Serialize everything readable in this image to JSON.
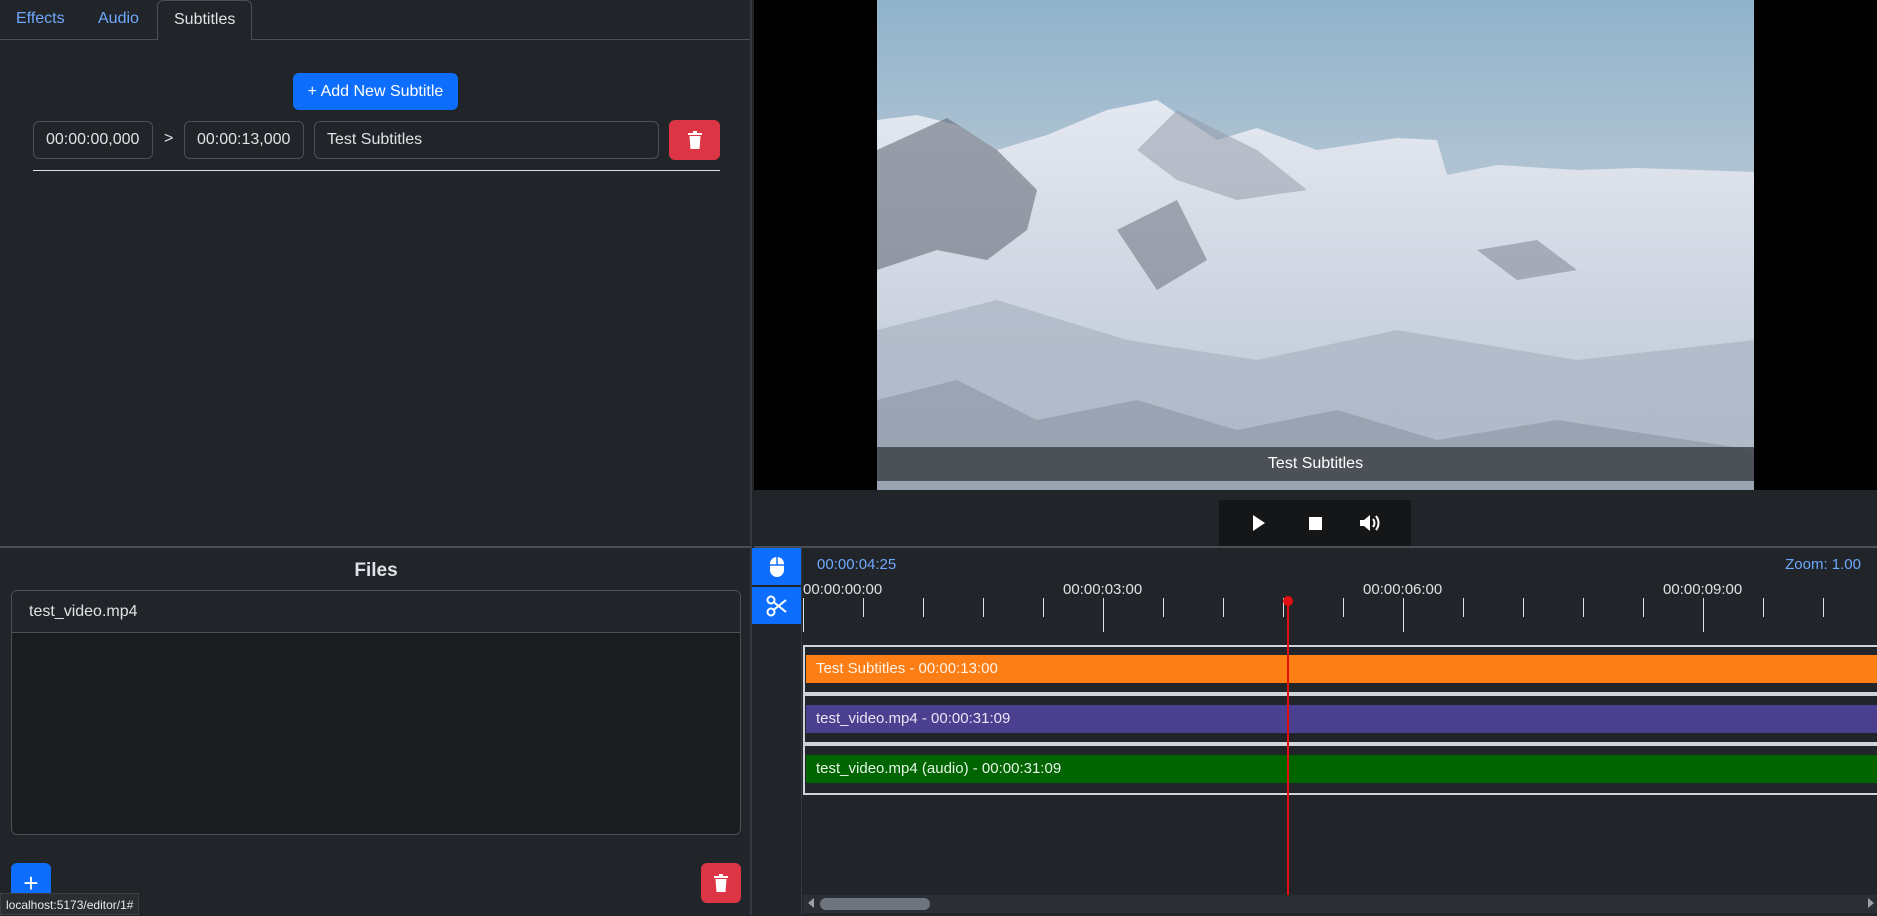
{
  "tabs": [
    {
      "label": "Effects",
      "active": false
    },
    {
      "label": "Audio",
      "active": false
    },
    {
      "label": "Subtitles",
      "active": true
    }
  ],
  "subtitles": {
    "add_button_label": "+ Add New Subtitle",
    "separator": ">",
    "entries": [
      {
        "start": "00:00:00,000",
        "end": "00:00:13,000",
        "text": "Test Subtitles"
      }
    ]
  },
  "files": {
    "title": "Files",
    "items": [
      "test_video.mp4"
    ],
    "add_label": "+"
  },
  "video": {
    "subtitle_overlay": "Test Subtitles"
  },
  "controls": {
    "play_icon": "play-icon",
    "stop_icon": "stop-icon",
    "volume_icon": "volume-icon"
  },
  "timeline": {
    "current_time": "00:00:04:25",
    "zoom": "Zoom: 1.00",
    "tool_icons": [
      "mouse-icon",
      "scissors-icon"
    ],
    "ruler_labels": [
      "00:00:00:00",
      "00:00:03:00",
      "00:00:06:00",
      "00:00:09:00"
    ],
    "tracks": [
      {
        "label": "Test Subtitles - 00:00:13:00",
        "color": "#fd7e14"
      },
      {
        "label": "test_video.mp4 - 00:00:31:09",
        "color": "#4b3f8f"
      },
      {
        "label": "test_video.mp4 (audio) - 00:00:31:09",
        "color": "#006400"
      }
    ]
  },
  "status_bar": {
    "url": "localhost:5173/editor/1#"
  },
  "colors": {
    "background": "#212529",
    "primary": "#0d6efd",
    "danger": "#dc3545",
    "playhead": "#e01010",
    "link": "#6ea8fe"
  }
}
